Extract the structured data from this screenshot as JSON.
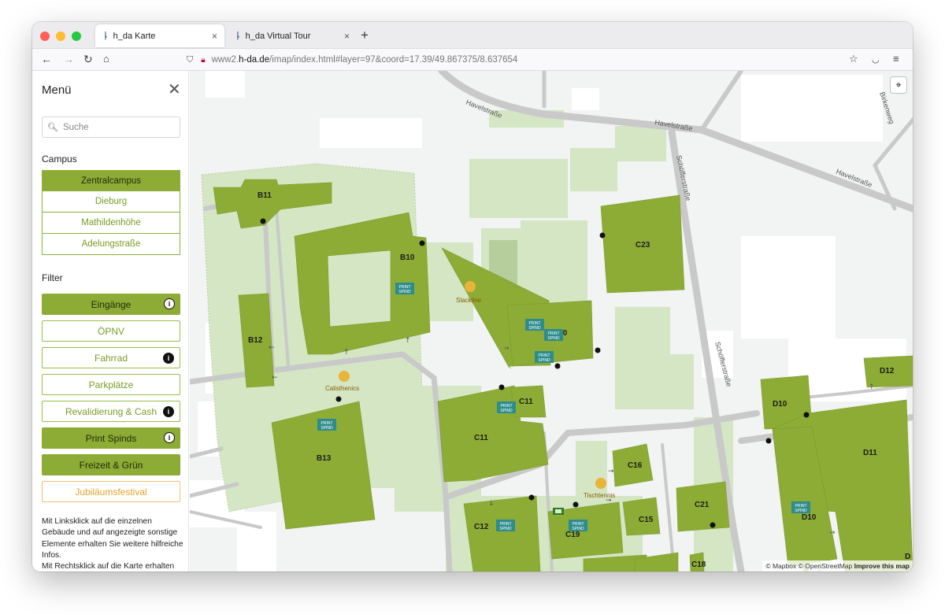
{
  "browser": {
    "tabs": [
      {
        "title": "h_da Karte",
        "active": true
      },
      {
        "title": "h_da Virtual Tour",
        "active": false
      }
    ],
    "new_tab": "+",
    "tab_close": "×",
    "url_prefix": "www2.",
    "url_host": "h-da.de",
    "url_path": "/imap/index.html#layer=97&coord=17.39/49.867375/8.637654",
    "lights": {
      "close": "#ff5f57",
      "minimize": "#febc2e",
      "maximize": "#28c840"
    }
  },
  "sidebar": {
    "title": "Menü",
    "close": "✕",
    "search_placeholder": "Suche",
    "campus_heading": "Campus",
    "campus": [
      {
        "label": "Zentralcampus",
        "selected": true
      },
      {
        "label": "Dieburg",
        "selected": false
      },
      {
        "label": "Mathildenhöhe",
        "selected": false
      },
      {
        "label": "Adelungstraße",
        "selected": false
      }
    ],
    "filter_heading": "Filter",
    "filters": [
      {
        "label": "Eingänge",
        "active": true,
        "info": true
      },
      {
        "label": "ÖPNV",
        "active": false,
        "info": false
      },
      {
        "label": "Fahrrad",
        "active": false,
        "info": true
      },
      {
        "label": "Parkplätze",
        "active": false,
        "info": false
      },
      {
        "label": "Revalidierung & Cash",
        "active": false,
        "info": true
      },
      {
        "label": "Print Spinds",
        "active": true,
        "info": true
      },
      {
        "label": "Freizeit & Grün",
        "active": true,
        "info": false
      },
      {
        "label": "Jubiläumsfestival",
        "active": false,
        "info": false
      }
    ],
    "help_line1": "Mit Linksklick auf die einzelnen Gebäude und auf angezeigte sonstige Elemente erhalten Sie weitere hilfreiche Infos.",
    "help_line2": "Mit Rechtsklick auf die Karte erhalten",
    "info_glyph": "i"
  },
  "map": {
    "streets": [
      "Havelstraße",
      "Havelstraße",
      "Havelstraße",
      "Schöfferstraße",
      "Schöfferstraße",
      "Birkenweg"
    ],
    "buildings": [
      "B11",
      "B10",
      "B12",
      "B13",
      "C23",
      "C10",
      "C11",
      "C11",
      "C16",
      "C15",
      "C12",
      "C19",
      "C21",
      "C18",
      "D12",
      "D10",
      "D11",
      "D10",
      "D"
    ],
    "poi": [
      "Slackline",
      "Calisthenics",
      "Tischtennis"
    ],
    "print_spind_label_1": "PRINT",
    "print_spind_label_2": "SPIND",
    "attribution_mapbox": "© Mapbox",
    "attribution_osm": "© OpenStreetMap",
    "attribution_improve": "Improve this map",
    "colors": {
      "building": "#8dac36",
      "green_area": "#d4e6c4",
      "road": "#c9c9c9",
      "locker": "#2e8c8c",
      "poi": "#e8b43a"
    }
  }
}
